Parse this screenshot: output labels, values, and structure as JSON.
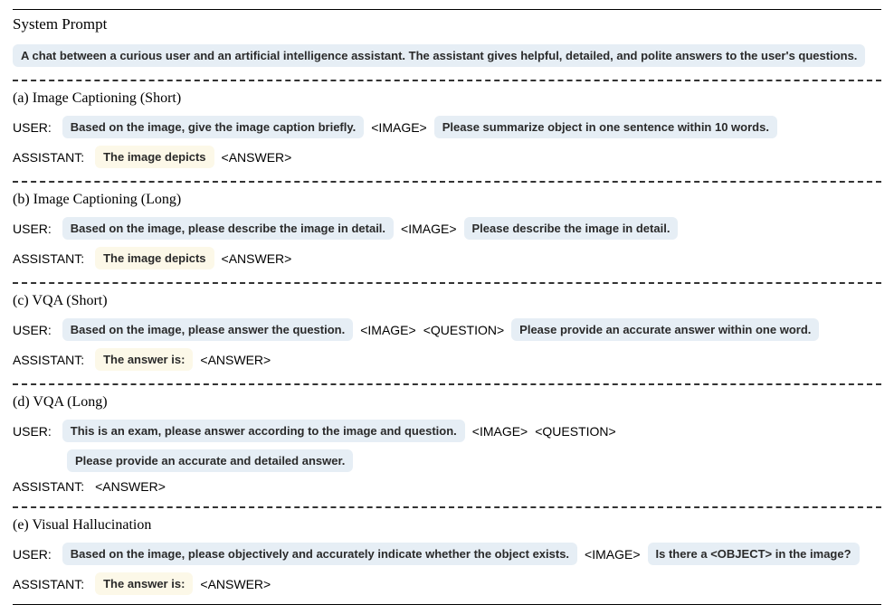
{
  "system": {
    "title": "System Prompt",
    "prompt": "A chat between a curious user and an artificial intelligence assistant. The assistant gives helpful, detailed, and polite answers to the user's questions."
  },
  "tokens": {
    "image": "<IMAGE>",
    "answer": "<ANSWER>",
    "question": "<QUESTION>",
    "object": "<OBJECT>"
  },
  "roles": {
    "user": "USER:",
    "assistant": "ASSISTANT:"
  },
  "sections": {
    "a": {
      "title": "(a) Image Captioning (Short)",
      "user_chip1": "Based on the image, give the image caption briefly.",
      "user_chip2": "Please summarize object in one sentence within 10 words.",
      "assistant_chip": "The image depicts"
    },
    "b": {
      "title": "(b) Image Captioning (Long)",
      "user_chip1": "Based on the image, please describe the image in detail.",
      "user_chip2": "Please describe the image in detail.",
      "assistant_chip": "The image depicts"
    },
    "c": {
      "title": "(c) VQA (Short)",
      "user_chip1": "Based on the image, please answer the question.",
      "user_chip2": "Please provide an accurate answer within one word.",
      "assistant_chip": "The answer is:"
    },
    "d": {
      "title": "(d) VQA (Long)",
      "user_chip1": "This is an exam, please answer according to the image and question.",
      "user_chip2": "Please provide an accurate and detailed answer."
    },
    "e": {
      "title": "(e) Visual Hallucination",
      "user_chip1": "Based on the image, please objectively and accurately indicate whether the object exists.",
      "user_chip2_prefix": "Is there a ",
      "user_chip2_suffix": " in the image?",
      "assistant_chip": "The answer is:"
    }
  }
}
